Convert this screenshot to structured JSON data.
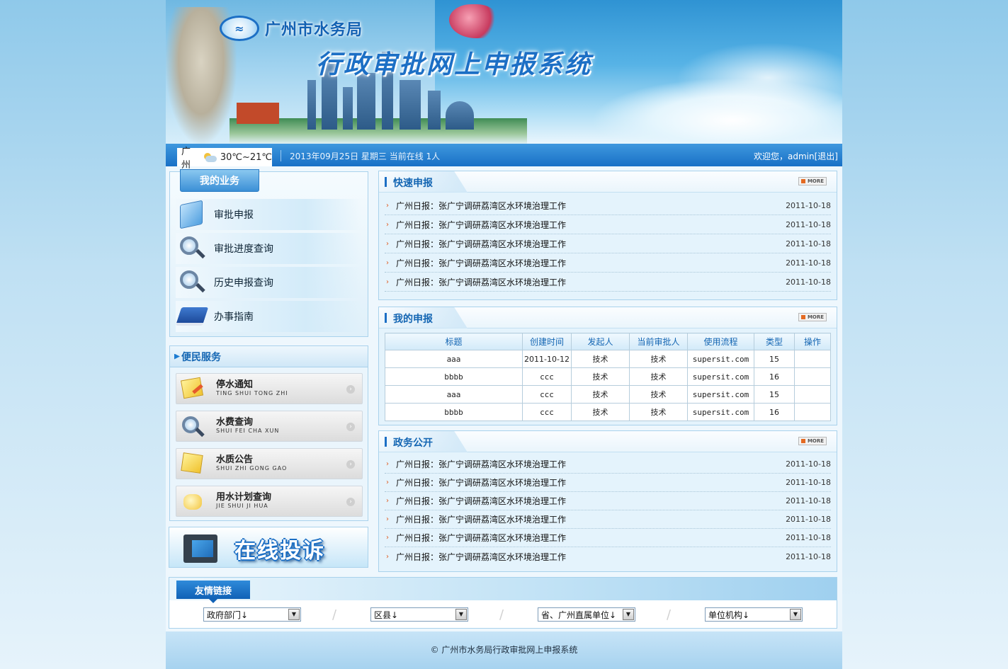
{
  "header": {
    "org_name": "广州市水务局",
    "system_title": "行政审批网上申报系统"
  },
  "status_bar": {
    "city": "广州",
    "temperature": "30℃~21℃",
    "date_line": "2013年09月25日 星期三  当前在线 1人",
    "welcome_prefix": "欢迎您，",
    "user": "admin",
    "logout": "[退出]"
  },
  "my_business": {
    "title": "我的业务",
    "items": [
      {
        "label": "审批申报",
        "icon": "folder-icon"
      },
      {
        "label": "审批进度查询",
        "icon": "magnifier-icon"
      },
      {
        "label": "历史申报查询",
        "icon": "magnifier-doc-icon"
      },
      {
        "label": "办事指南",
        "icon": "book-icon"
      }
    ]
  },
  "services": {
    "title": "便民服务",
    "items": [
      {
        "title": "停水通知",
        "pinyin": "TING SHUI TONG ZHI",
        "icon": "note-pencil-icon"
      },
      {
        "title": "水费查询",
        "pinyin": "SHUI FEI CHA XUN",
        "icon": "magnifier-icon"
      },
      {
        "title": "水质公告",
        "pinyin": "SHUI ZHI GONG GAO",
        "icon": "sticky-notes-icon"
      },
      {
        "title": "用水计划查询",
        "pinyin": "JIE SHUI JI HUA",
        "icon": "water-plan-icon"
      }
    ]
  },
  "complaint": {
    "label": "在线投诉"
  },
  "quick_declare": {
    "title": "快速申报",
    "more": "MORE",
    "items": [
      {
        "title": "广州日报：张广宁调研荔湾区水环境治理工作",
        "date": "2011-10-18"
      },
      {
        "title": "广州日报：张广宁调研荔湾区水环境治理工作",
        "date": "2011-10-18"
      },
      {
        "title": "广州日报：张广宁调研荔湾区水环境治理工作",
        "date": "2011-10-18"
      },
      {
        "title": "广州日报：张广宁调研荔湾区水环境治理工作",
        "date": "2011-10-18"
      },
      {
        "title": "广州日报：张广宁调研荔湾区水环境治理工作",
        "date": "2011-10-18"
      }
    ]
  },
  "my_declare": {
    "title": "我的申报",
    "more": "MORE",
    "columns": [
      "标题",
      "创建时间",
      "发起人",
      "当前审批人",
      "使用流程",
      "类型",
      "操作"
    ],
    "rows": [
      [
        "aaa",
        "2011-10-12",
        "技术",
        "技术",
        "supersit.com",
        "15",
        ""
      ],
      [
        "bbbb",
        "ccc",
        "技术",
        "技术",
        "supersit.com",
        "16",
        ""
      ],
      [
        "aaa",
        "ccc",
        "技术",
        "技术",
        "supersit.com",
        "15",
        ""
      ],
      [
        "bbbb",
        "ccc",
        "技术",
        "技术",
        "supersit.com",
        "16",
        ""
      ]
    ]
  },
  "gov_affairs": {
    "title": "政务公开",
    "more": "MORE",
    "items": [
      {
        "title": "广州日报：张广宁调研荔湾区水环境治理工作",
        "date": "2011-10-18"
      },
      {
        "title": "广州日报：张广宁调研荔湾区水环境治理工作",
        "date": "2011-10-18"
      },
      {
        "title": "广州日报：张广宁调研荔湾区水环境治理工作",
        "date": "2011-10-18"
      },
      {
        "title": "广州日报：张广宁调研荔湾区水环境治理工作",
        "date": "2011-10-18"
      },
      {
        "title": "广州日报：张广宁调研荔湾区水环境治理工作",
        "date": "2011-10-18"
      },
      {
        "title": "广州日报：张广宁调研荔湾区水环境治理工作",
        "date": "2011-10-18"
      }
    ]
  },
  "links": {
    "title": "友情链接",
    "selects": [
      "政府部门↓",
      "区县↓",
      "省、广州直属单位↓",
      "单位机构↓"
    ]
  },
  "footer": {
    "text": "© 广州市水务局行政审批网上申报系统"
  }
}
